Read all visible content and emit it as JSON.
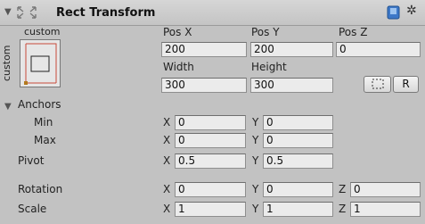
{
  "component": {
    "title": "Rect Transform"
  },
  "anchor_preset": {
    "top_label": "custom",
    "side_label": "custom"
  },
  "position": {
    "pos_x_label": "Pos X",
    "pos_y_label": "Pos Y",
    "pos_z_label": "Pos Z",
    "pos_x": "200",
    "pos_y": "200",
    "pos_z": "0"
  },
  "size": {
    "width_label": "Width",
    "height_label": "Height",
    "width": "300",
    "height": "300"
  },
  "buttons": {
    "raw_edit_label": "R"
  },
  "anchors": {
    "label": "Anchors",
    "min_label": "Min",
    "max_label": "Max",
    "min_x": "0",
    "min_y": "0",
    "max_x": "0",
    "max_y": "0"
  },
  "pivot": {
    "label": "Pivot",
    "x": "0.5",
    "y": "0.5"
  },
  "rotation": {
    "label": "Rotation",
    "x": "0",
    "y": "0",
    "z": "0"
  },
  "scale": {
    "label": "Scale",
    "x": "1",
    "y": "1",
    "z": "1"
  },
  "axis": {
    "x": "X",
    "y": "Y",
    "z": "Z"
  },
  "colors": {
    "panel": "#c2c2c2",
    "field": "#ebebeb",
    "anchor_red": "#c8493a"
  },
  "icons": {
    "foldout": "foldout-arrow-icon",
    "component": "rect-transform-icon",
    "help": "help-book-icon",
    "settings": "gear-icon",
    "blueprint": "blueprint-mode-icon"
  }
}
